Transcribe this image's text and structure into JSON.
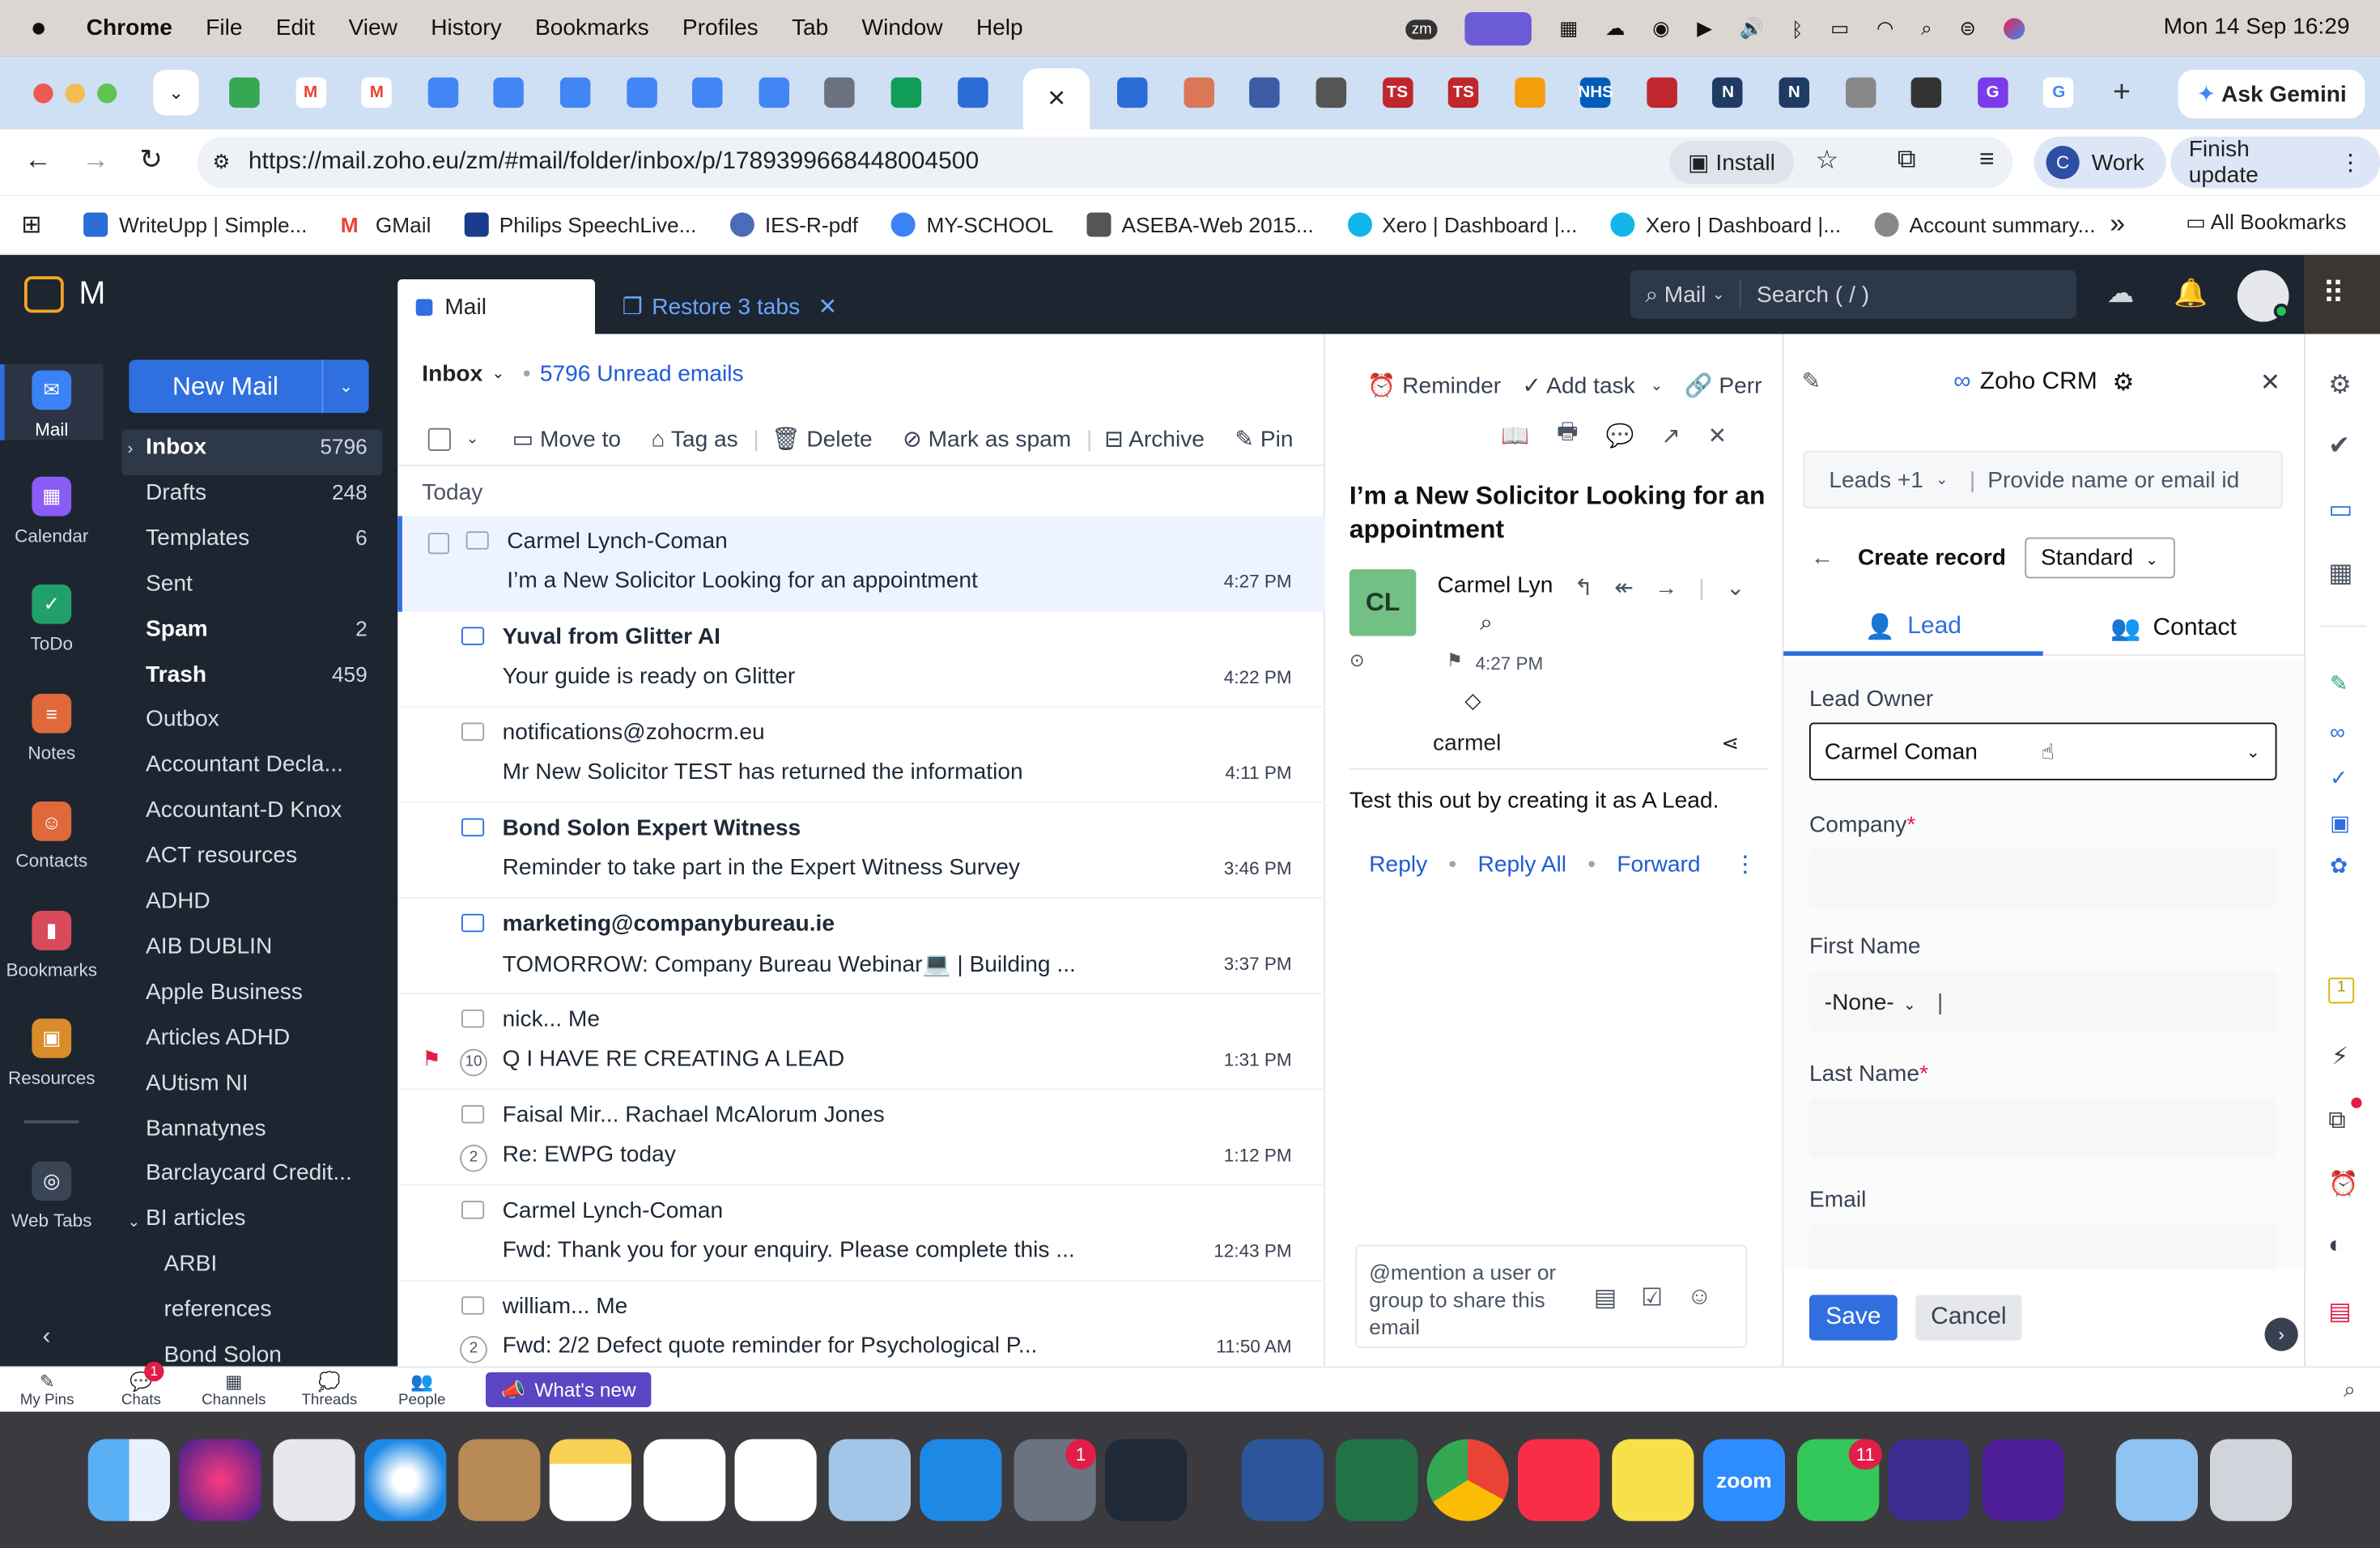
{
  "menubar": {
    "app": "Chrome",
    "items": [
      "File",
      "Edit",
      "View",
      "History",
      "Bookmarks",
      "Profiles",
      "Tab",
      "Window",
      "Help"
    ],
    "clock": "Mon 14 Sep  16:29",
    "zm": "zm"
  },
  "tabs": {
    "new_tab": "+",
    "ask_gemini": "Ask Gemini",
    "active_close": "×"
  },
  "address": {
    "url": "https://mail.zoho.eu/zm/#mail/folder/inbox/p/1789399668448004500",
    "install": "Install",
    "profile_initial": "C",
    "profile": "Work",
    "finish_update": "Finish update"
  },
  "bookmarks": {
    "items": [
      "WriteUpp | Simple...",
      "GMail",
      "Philips SpeechLive...",
      "IES-R-pdf",
      "MY-SCHOOL",
      "ASEBA-Web 2015...",
      "Xero | Dashboard |...",
      "Xero | Dashboard |...",
      "Account summary..."
    ],
    "more": "»",
    "all": "All Bookmarks"
  },
  "zoho": {
    "brand": "Mail",
    "apps": [
      "Mail",
      "Calendar",
      "ToDo",
      "Notes",
      "Contacts",
      "Bookmarks",
      "Resources",
      "Web Tabs"
    ],
    "new_mail": "New Mail",
    "folders": [
      {
        "name": "Inbox",
        "count": "5796",
        "bold": true
      },
      {
        "name": "Drafts",
        "count": "248"
      },
      {
        "name": "Templates",
        "count": "6"
      },
      {
        "name": "Sent",
        "count": ""
      },
      {
        "name": "Spam",
        "count": "2",
        "bold": true
      },
      {
        "name": "Trash",
        "count": "459",
        "bold": true
      },
      {
        "name": "Outbox",
        "count": ""
      },
      {
        "name": "Accountant Decla...",
        "count": ""
      },
      {
        "name": "Accountant-D Knox",
        "count": ""
      },
      {
        "name": "ACT resources",
        "count": ""
      },
      {
        "name": "ADHD",
        "count": ""
      },
      {
        "name": "AIB DUBLIN",
        "count": ""
      },
      {
        "name": "Apple Business",
        "count": ""
      },
      {
        "name": "Articles ADHD",
        "count": ""
      },
      {
        "name": "AUtism NI",
        "count": ""
      },
      {
        "name": "Bannatynes",
        "count": ""
      },
      {
        "name": "Barclaycard Credit...",
        "count": ""
      },
      {
        "name": "BI articles",
        "count": ""
      },
      {
        "name": "ARBI",
        "count": ""
      },
      {
        "name": "references",
        "count": ""
      },
      {
        "name": "Bond Solon",
        "count": ""
      }
    ],
    "top_tab": "Mail",
    "restore": "Restore 3 tabs",
    "search_scope": "Mail",
    "search_placeholder": "Search ( / )"
  },
  "list": {
    "folder": "Inbox",
    "unread": "5796 Unread emails",
    "toolbar": [
      "Move to",
      "Tag as",
      "Delete",
      "Mark as spam",
      "Archive",
      "Pin"
    ],
    "group": "Today",
    "emails": [
      {
        "sender": "Carmel Lynch-Coman",
        "subject": "I’m a New Solicitor Looking for an appointment",
        "time": "4:27 PM",
        "bold": false,
        "selected": true,
        "count": ""
      },
      {
        "sender": "Yuval from Glitter AI",
        "subject": "Your guide is ready on Glitter",
        "time": "4:22 PM",
        "bold": true,
        "count": ""
      },
      {
        "sender": "notifications@zohocrm.eu",
        "subject": "Mr New Solicitor TEST has returned the information",
        "time": "4:11 PM",
        "bold": false,
        "count": ""
      },
      {
        "sender": "Bond Solon Expert Witness",
        "subject": "Reminder to take part in the Expert Witness Survey",
        "time": "3:46 PM",
        "bold": true,
        "count": ""
      },
      {
        "sender": "marketing@companybureau.ie",
        "subject": "TOMORROW: Company Bureau Webinar💻 | Building ...",
        "time": "3:37 PM",
        "bold": true,
        "count": ""
      },
      {
        "sender": "nick... Me",
        "subject": "Q I HAVE RE CREATING A LEAD",
        "time": "1:31 PM",
        "bold": false,
        "count": "10",
        "flag": true
      },
      {
        "sender": "Faisal Mir... Rachael McAlorum Jones",
        "subject": "Re: EWPG today",
        "time": "1:12 PM",
        "bold": false,
        "count": "2"
      },
      {
        "sender": "Carmel Lynch-Coman",
        "subject": "Fwd: Thank you for your enquiry. Please complete this ...",
        "time": "12:43 PM",
        "bold": false,
        "count": ""
      },
      {
        "sender": "william... Me",
        "subject": "Fwd: 2/2 Defect quote reminder for Psychological P...",
        "time": "11:50 AM",
        "bold": false,
        "count": "2"
      }
    ]
  },
  "reader": {
    "reminder": "Reminder",
    "add_task": "Add task",
    "perm": "Perr",
    "subject": "I’m a New Solicitor Looking for an appointment",
    "avatar": "CL",
    "from": "Carmel Lyn",
    "time": "4:27 PM",
    "to": "carmel",
    "body": "Test this out by creating it as A Lead.",
    "reply": "Reply",
    "reply_all": "Reply All",
    "forward": "Forward",
    "comment_placeholder": "@mention a user or group to share this email"
  },
  "crm": {
    "title": "Zoho CRM",
    "module": "Leads +1",
    "search_placeholder": "Provide name or email id",
    "create_record": "Create record",
    "layout": "Standard",
    "tab_lead": "Lead",
    "tab_contact": "Contact",
    "lead_owner_label": "Lead Owner",
    "lead_owner": "Carmel Coman",
    "company_label": "Company",
    "first_name_label": "First Name",
    "salutation": "-None-",
    "last_name_label": "Last Name",
    "email_label": "Email",
    "save": "Save",
    "cancel": "Cancel"
  },
  "bottom": {
    "items": [
      "My Pins",
      "Chats",
      "Channels",
      "Threads",
      "People"
    ],
    "chats_badge": "1",
    "whats_new": "What's new"
  },
  "dock": {
    "settings_badge": "1",
    "facetime_badge": "11",
    "zoom": "zoom"
  }
}
